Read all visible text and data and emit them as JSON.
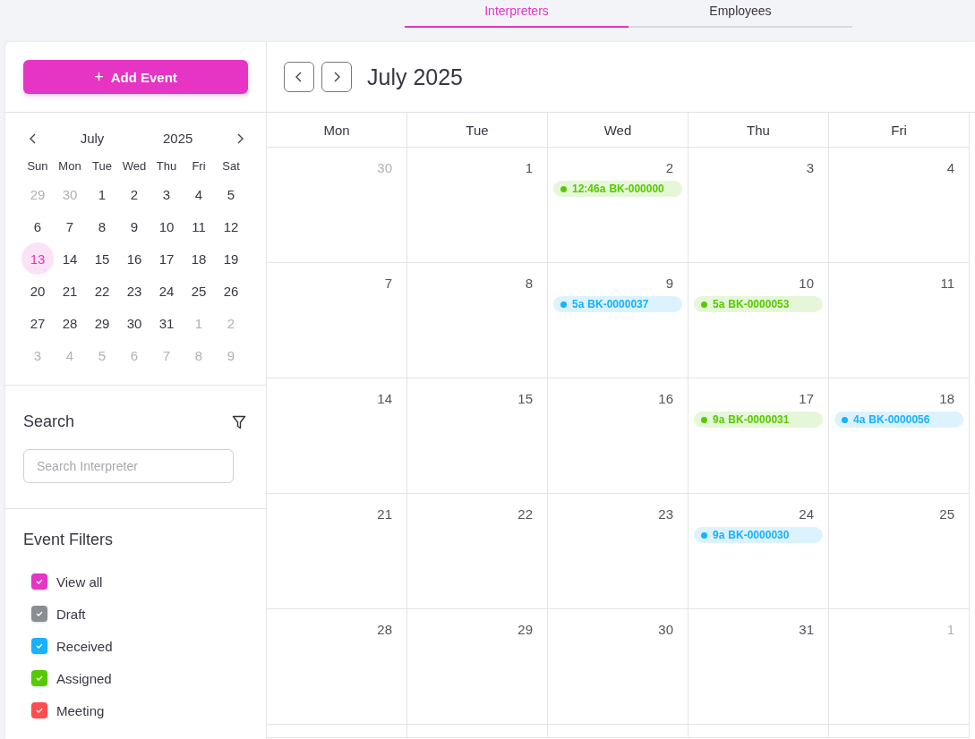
{
  "tabs": [
    {
      "label": "Interpreters",
      "selected": true
    },
    {
      "label": "Employees",
      "selected": false
    }
  ],
  "sidebar": {
    "add_button": {
      "icon": "+",
      "label": "Add Event"
    },
    "mini_calendar": {
      "month": "July",
      "year": "2025",
      "weekdays": [
        "Sun",
        "Mon",
        "Tue",
        "Wed",
        "Thu",
        "Fri",
        "Sat"
      ],
      "days": [
        {
          "label": "29",
          "muted": true,
          "selected": false
        },
        {
          "label": "30",
          "muted": true,
          "selected": false
        },
        {
          "label": "1",
          "muted": false,
          "selected": false
        },
        {
          "label": "2",
          "muted": false,
          "selected": false
        },
        {
          "label": "3",
          "muted": false,
          "selected": false
        },
        {
          "label": "4",
          "muted": false,
          "selected": false
        },
        {
          "label": "5",
          "muted": false,
          "selected": false
        },
        {
          "label": "6",
          "muted": false,
          "selected": false
        },
        {
          "label": "7",
          "muted": false,
          "selected": false
        },
        {
          "label": "8",
          "muted": false,
          "selected": false
        },
        {
          "label": "9",
          "muted": false,
          "selected": false
        },
        {
          "label": "10",
          "muted": false,
          "selected": false
        },
        {
          "label": "11",
          "muted": false,
          "selected": false
        },
        {
          "label": "12",
          "muted": false,
          "selected": false
        },
        {
          "label": "13",
          "muted": false,
          "selected": true
        },
        {
          "label": "14",
          "muted": false,
          "selected": false
        },
        {
          "label": "15",
          "muted": false,
          "selected": false
        },
        {
          "label": "16",
          "muted": false,
          "selected": false
        },
        {
          "label": "17",
          "muted": false,
          "selected": false
        },
        {
          "label": "18",
          "muted": false,
          "selected": false
        },
        {
          "label": "19",
          "muted": false,
          "selected": false
        },
        {
          "label": "20",
          "muted": false,
          "selected": false
        },
        {
          "label": "21",
          "muted": false,
          "selected": false
        },
        {
          "label": "22",
          "muted": false,
          "selected": false
        },
        {
          "label": "23",
          "muted": false,
          "selected": false
        },
        {
          "label": "24",
          "muted": false,
          "selected": false
        },
        {
          "label": "25",
          "muted": false,
          "selected": false
        },
        {
          "label": "26",
          "muted": false,
          "selected": false
        },
        {
          "label": "27",
          "muted": false,
          "selected": false
        },
        {
          "label": "28",
          "muted": false,
          "selected": false
        },
        {
          "label": "29",
          "muted": false,
          "selected": false
        },
        {
          "label": "30",
          "muted": false,
          "selected": false
        },
        {
          "label": "31",
          "muted": false,
          "selected": false
        },
        {
          "label": "1",
          "muted": true,
          "selected": false
        },
        {
          "label": "2",
          "muted": true,
          "selected": false
        },
        {
          "label": "3",
          "muted": true,
          "selected": false
        },
        {
          "label": "4",
          "muted": true,
          "selected": false
        },
        {
          "label": "5",
          "muted": true,
          "selected": false
        },
        {
          "label": "6",
          "muted": true,
          "selected": false
        },
        {
          "label": "7",
          "muted": true,
          "selected": false
        },
        {
          "label": "8",
          "muted": true,
          "selected": false
        },
        {
          "label": "9",
          "muted": true,
          "selected": false
        }
      ]
    },
    "search": {
      "title": "Search",
      "placeholder": "Search Interpreter"
    },
    "filters": {
      "title": "Event Filters",
      "items": [
        {
          "label": "View all",
          "checked": true,
          "color": "#e634c4"
        },
        {
          "label": "Draft",
          "checked": true,
          "color": "#8a8d93"
        },
        {
          "label": "Received",
          "checked": true,
          "color": "#16b1ff"
        },
        {
          "label": "Assigned",
          "checked": true,
          "color": "#56ca00"
        },
        {
          "label": "Meeting",
          "checked": true,
          "color": "#ff4c51"
        }
      ]
    }
  },
  "calendar": {
    "title": "July 2025",
    "columns": [
      "Mon",
      "Tue",
      "Wed",
      "Thu",
      "Fri"
    ],
    "weeks": [
      [
        {
          "day": "30",
          "muted": true
        },
        {
          "day": "1",
          "muted": false
        },
        {
          "day": "2",
          "muted": false,
          "events": [
            {
              "time": "12:46a",
              "ref": "BK-000000",
              "color": "#56ca00"
            }
          ]
        },
        {
          "day": "3",
          "muted": false
        },
        {
          "day": "4",
          "muted": false
        }
      ],
      [
        {
          "day": "7",
          "muted": false
        },
        {
          "day": "8",
          "muted": false
        },
        {
          "day": "9",
          "muted": false,
          "events": [
            {
              "time": "5a",
              "ref": "BK-0000037",
              "color": "#16b1ff"
            }
          ]
        },
        {
          "day": "10",
          "muted": false,
          "events": [
            {
              "time": "5a",
              "ref": "BK-0000053",
              "color": "#56ca00"
            }
          ]
        },
        {
          "day": "11",
          "muted": false
        }
      ],
      [
        {
          "day": "14",
          "muted": false
        },
        {
          "day": "15",
          "muted": false
        },
        {
          "day": "16",
          "muted": false
        },
        {
          "day": "17",
          "muted": false,
          "events": [
            {
              "time": "9a",
              "ref": "BK-0000031",
              "color": "#56ca00"
            }
          ]
        },
        {
          "day": "18",
          "muted": false,
          "events": [
            {
              "time": "4a",
              "ref": "BK-0000056",
              "color": "#16b1ff"
            }
          ]
        }
      ],
      [
        {
          "day": "21",
          "muted": false
        },
        {
          "day": "22",
          "muted": false
        },
        {
          "day": "23",
          "muted": false
        },
        {
          "day": "24",
          "muted": false,
          "events": [
            {
              "time": "9a",
              "ref": "BK-0000030",
              "color": "#16b1ff"
            }
          ]
        },
        {
          "day": "25",
          "muted": false
        }
      ],
      [
        {
          "day": "28",
          "muted": false
        },
        {
          "day": "29",
          "muted": false
        },
        {
          "day": "30",
          "muted": false
        },
        {
          "day": "31",
          "muted": false
        },
        {
          "day": "1",
          "muted": true
        }
      ]
    ]
  }
}
